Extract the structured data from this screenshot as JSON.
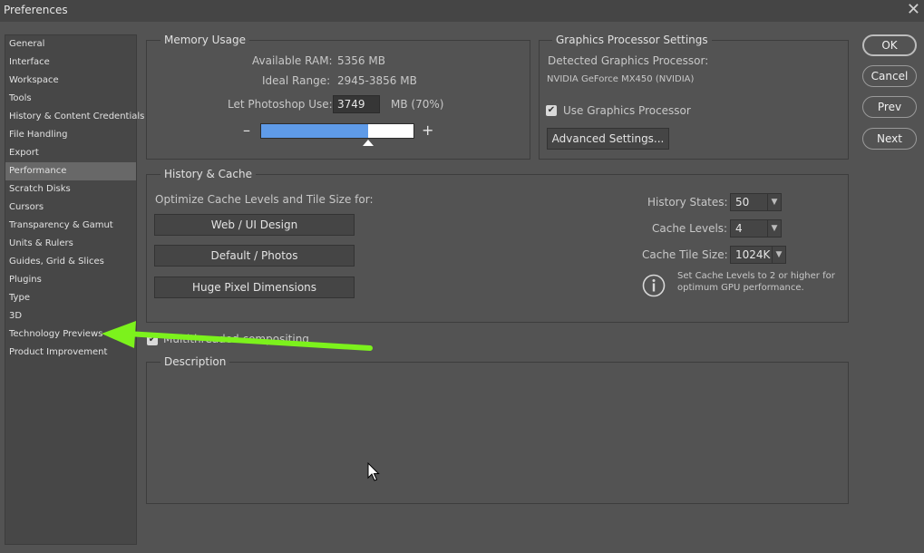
{
  "window": {
    "title": "Preferences",
    "close_icon": "close-icon"
  },
  "sidebar": {
    "selected": "Performance",
    "items": [
      {
        "label": "General"
      },
      {
        "label": "Interface"
      },
      {
        "label": "Workspace"
      },
      {
        "label": "Tools"
      },
      {
        "label": "History & Content Credentials"
      },
      {
        "label": "File Handling"
      },
      {
        "label": "Export"
      },
      {
        "label": "Performance"
      },
      {
        "label": "Scratch Disks"
      },
      {
        "label": "Cursors"
      },
      {
        "label": "Transparency & Gamut"
      },
      {
        "label": "Units & Rulers"
      },
      {
        "label": "Guides, Grid & Slices"
      },
      {
        "label": "Plugins"
      },
      {
        "label": "Type"
      },
      {
        "label": "3D"
      },
      {
        "label": "Technology Previews"
      },
      {
        "label": "Product Improvement"
      }
    ]
  },
  "memory": {
    "heading": "Memory Usage",
    "available_label": "Available RAM:",
    "available_value": "5356 MB",
    "ideal_label": "Ideal Range:",
    "ideal_value": "2945-3856 MB",
    "let_label": "Let Photoshop Use:",
    "let_value": "3749",
    "let_unit": "MB (70%)",
    "slider_fraction": 0.7,
    "minus": "–",
    "plus": "+"
  },
  "gpu": {
    "heading": "Graphics Processor Settings",
    "detected_label": "Detected Graphics Processor:",
    "detected_value": "NVIDIA GeForce MX450 (NVIDIA)",
    "use_gpu_label": "Use Graphics Processor",
    "use_gpu_checked": true,
    "advanced_label": "Advanced Settings..."
  },
  "history_cache": {
    "heading": "History & Cache",
    "optimize_label": "Optimize Cache Levels and Tile Size for:",
    "buttons": [
      "Web / UI Design",
      "Default / Photos",
      "Huge Pixel Dimensions"
    ],
    "history_states_label": "History States:",
    "history_states_value": "50",
    "cache_levels_label": "Cache Levels:",
    "cache_levels_value": "4",
    "tile_size_label": "Cache Tile Size:",
    "tile_size_value": "1024K",
    "info_line1": "Set Cache Levels to 2 or higher for",
    "info_line2": "optimum GPU performance."
  },
  "multithreaded": {
    "label": "Multithreaded compositing",
    "checked": true
  },
  "description": {
    "heading": "Description"
  },
  "actions": {
    "ok": "OK",
    "cancel": "Cancel",
    "prev": "Prev",
    "next": "Next"
  },
  "colors": {
    "accent_blue": "#5f9be8",
    "annotation_green": "#7cf21c",
    "background": "#535353"
  }
}
